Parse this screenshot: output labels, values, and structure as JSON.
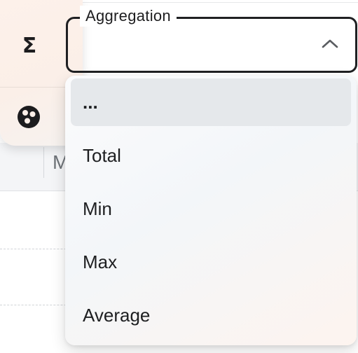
{
  "background_table": {
    "column_header_fragment": "M"
  },
  "toolbar": {
    "icons": [
      "sigma-icon",
      "palette-icon"
    ]
  },
  "aggregation_select": {
    "label": "Aggregation",
    "value": "",
    "expanded": true,
    "options": [
      {
        "label": "...",
        "selected": true
      },
      {
        "label": "Total",
        "selected": false
      },
      {
        "label": "Min",
        "selected": false
      },
      {
        "label": "Max",
        "selected": false
      },
      {
        "label": "Average",
        "selected": false
      }
    ]
  },
  "colors": {
    "field_border": "#1f2022",
    "selected_option_bg": "#e5e8eb",
    "rail_bg": "#fdf1ea"
  }
}
